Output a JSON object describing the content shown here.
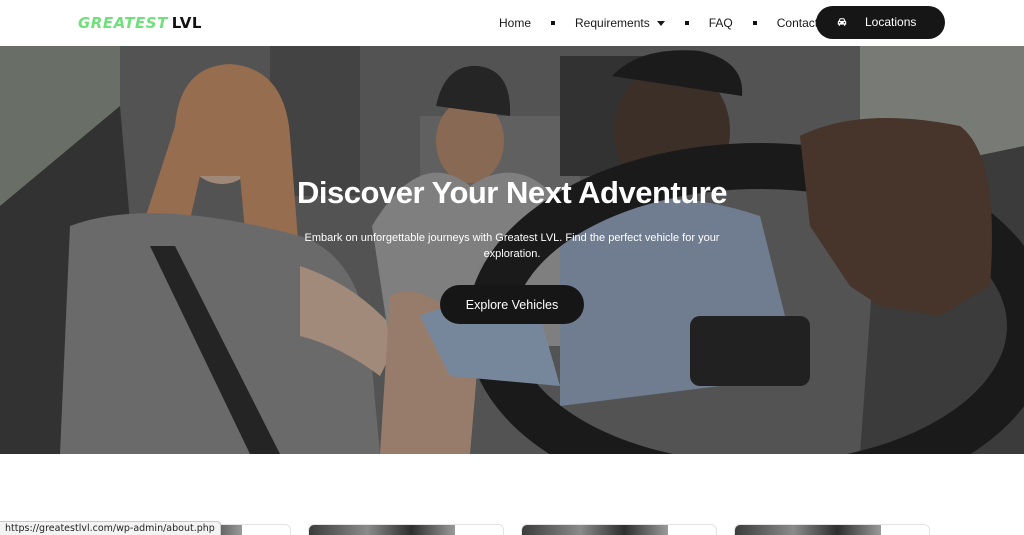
{
  "header": {
    "logo": {
      "part1": "GREATEST",
      "part2": "LVL"
    },
    "nav": [
      {
        "label": "Home"
      },
      {
        "label": "Requirements"
      },
      {
        "label": "FAQ"
      },
      {
        "label": "Contact"
      }
    ],
    "locations_button": {
      "label": "Locations",
      "icon": "car-icon"
    }
  },
  "hero": {
    "title": "Discover Your Next Adventure",
    "subtitle": "Embark on unforgettable journeys with Greatest LVL. Find the perfect vehicle for your exploration.",
    "button_label": "Explore Vehicles",
    "image": "hero-photo"
  },
  "status_bar": {
    "url": "https://greatestlvl.com/wp-admin/about.php"
  },
  "colors": {
    "brand_green": "#6fe07a",
    "dark": "#161616"
  }
}
